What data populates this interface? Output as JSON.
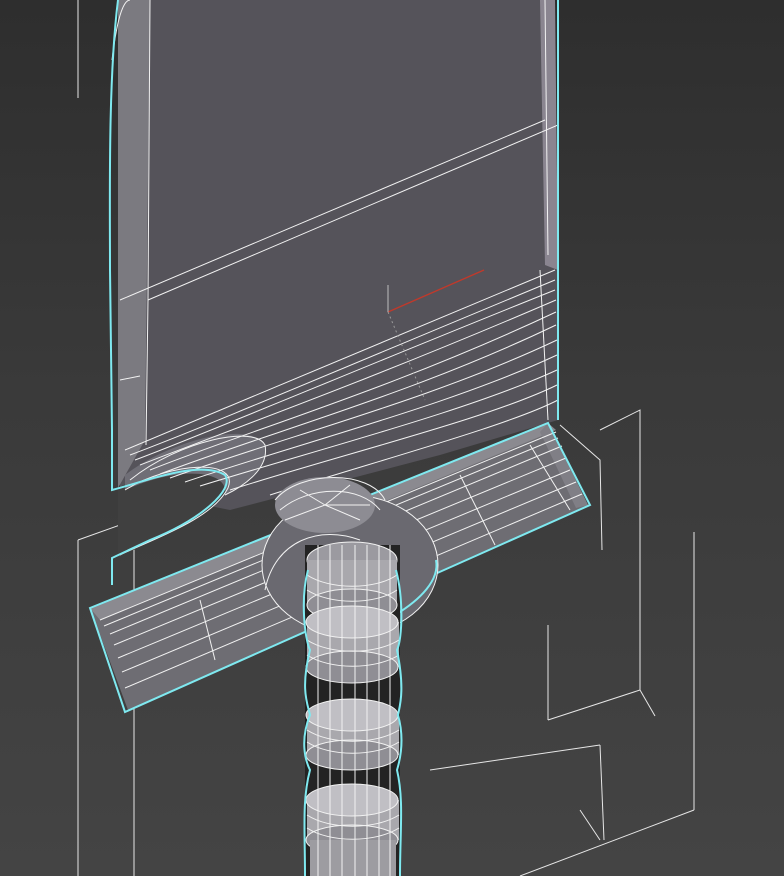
{
  "viewport": {
    "background": "#3c3c3c",
    "selection_color": "#7fe9f0",
    "wire_color": "#f2f2f2",
    "axis_x_color": "#c0392b"
  }
}
